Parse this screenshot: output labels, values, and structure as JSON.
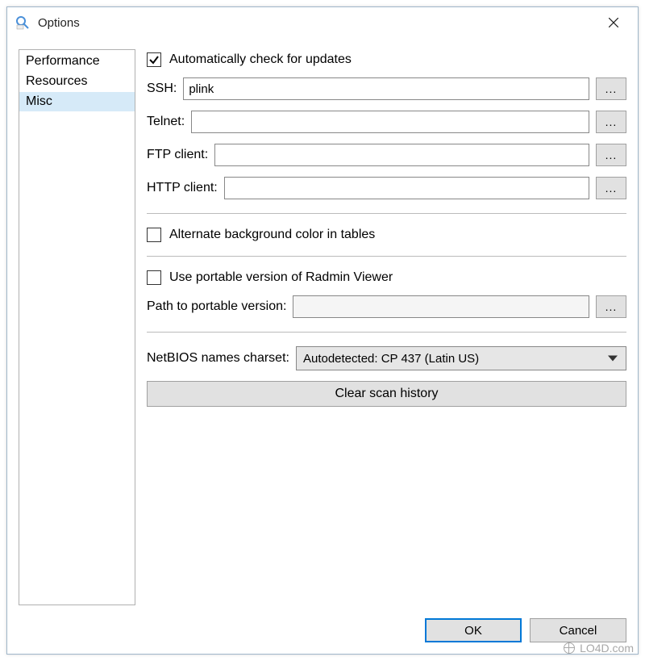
{
  "window": {
    "title": "Options"
  },
  "sidebar": {
    "items": [
      {
        "label": "Performance",
        "selected": false
      },
      {
        "label": "Resources",
        "selected": false
      },
      {
        "label": "Misc",
        "selected": true
      }
    ]
  },
  "panel": {
    "auto_update": {
      "checked": true,
      "label": "Automatically check for updates"
    },
    "ssh": {
      "label": "SSH:",
      "value": "plink",
      "browse": "..."
    },
    "telnet": {
      "label": "Telnet:",
      "value": "",
      "browse": "..."
    },
    "ftp": {
      "label": "FTP client:",
      "value": "",
      "browse": "..."
    },
    "http": {
      "label": "HTTP client:",
      "value": "",
      "browse": "..."
    },
    "alt_bg": {
      "checked": false,
      "label": "Alternate background color in tables"
    },
    "portable": {
      "checked": false,
      "label": "Use portable version of Radmin Viewer"
    },
    "portable_path": {
      "label": "Path to portable version:",
      "value": "",
      "browse": "...",
      "disabled": true
    },
    "netbios": {
      "label": "NetBIOS names charset:",
      "value": "Autodetected: CP 437 (Latin US)"
    },
    "clear_history": {
      "label": "Clear scan history"
    }
  },
  "footer": {
    "ok": "OK",
    "cancel": "Cancel"
  },
  "watermark": "LO4D.com"
}
